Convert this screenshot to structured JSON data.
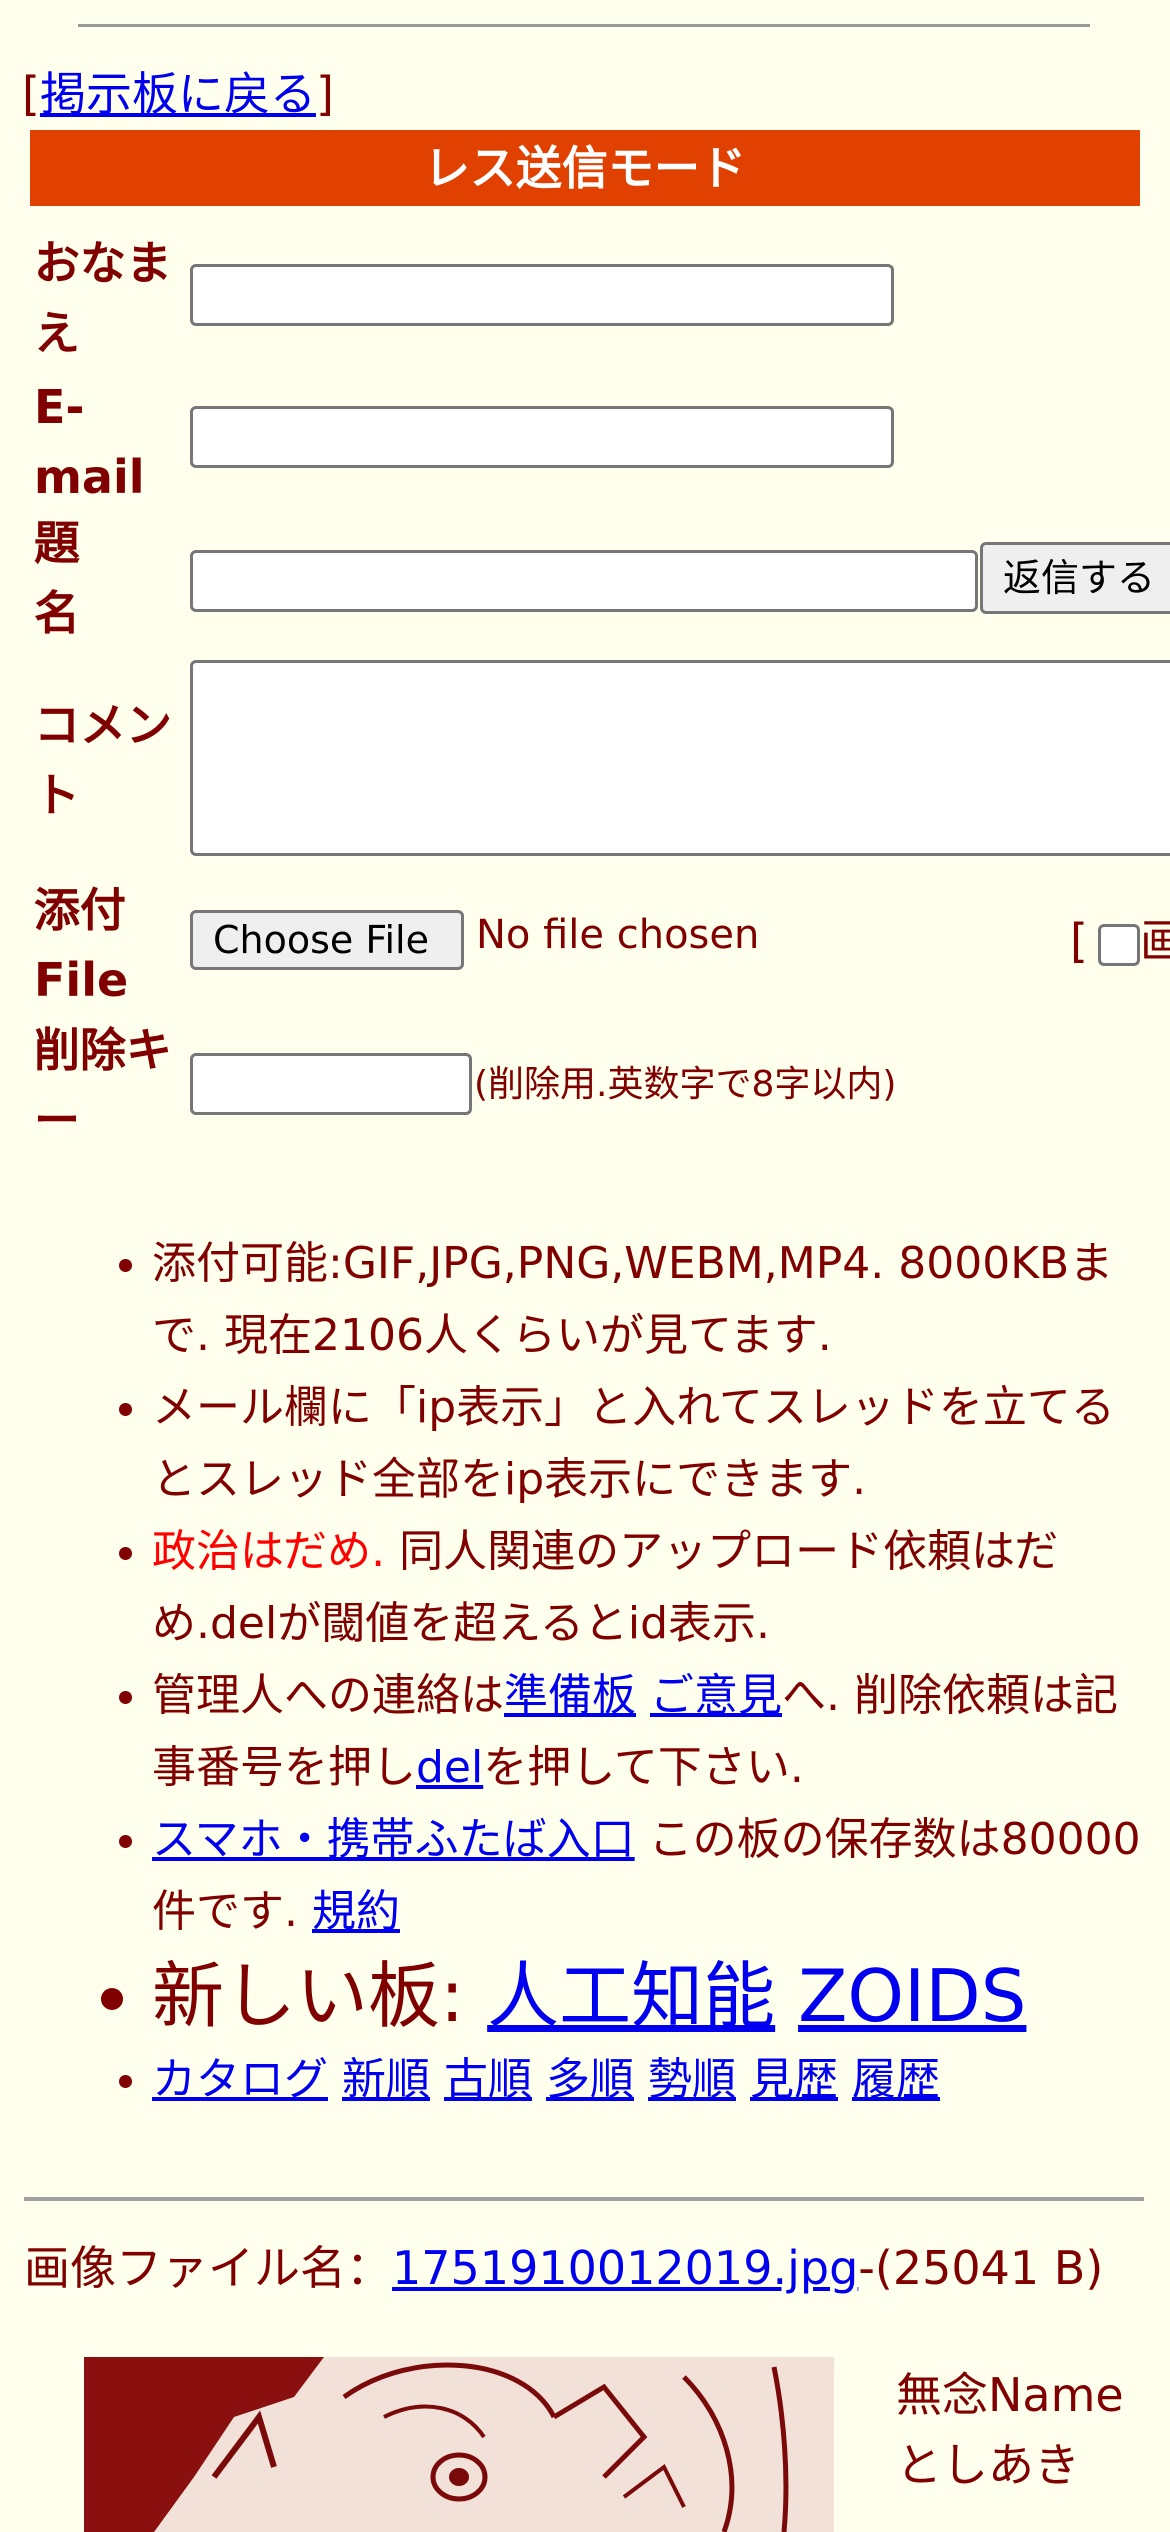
{
  "nav": {
    "back_link": "掲示板に戻る"
  },
  "form": {
    "mode_title": "レス送信モード",
    "label_name": "おなまえ",
    "label_email": "E-mail",
    "label_subject": "題名",
    "label_comment": "コメント",
    "label_file": "添付File",
    "label_delkey": "削除キー",
    "submit_label": "返信する",
    "file_button_label": "Choose File",
    "file_status": "No file chosen",
    "image_option_text": "画",
    "delkey_note": "(削除用.英数字で8字以内)"
  },
  "rules": {
    "r1": "添付可能:GIF,JPG,PNG,WEBM,MP4. 8000KBまで. 現在2106人くらいが見てます.",
    "r2": "メール欄に「ip表示」と入れてスレッドを立てるとスレッド全部をip表示にできます.",
    "r3_red": "政治はだめ.",
    "r3_rest": " 同人関連のアップロード依頼はだめ.delが閾値を超えるとid表示.",
    "r4_a": "管理人への連絡は",
    "r4_link1": "準備板",
    "r4_link2": "ご意見",
    "r4_b": "へ. 削除依頼は記事番号を押し",
    "r4_link3": "del",
    "r4_c": "を押して下さい.",
    "r5_link": "スマホ・携帯ふたば入口",
    "r5_text": " この板の保存数は80000件です. ",
    "r5_link2": "規約",
    "new_boards_label": "新しい板: ",
    "new_board_1": "人工知能",
    "new_board_2": "ZOIDS",
    "sort_links": [
      "カタログ",
      "新順",
      "古順",
      "多順",
      "勢順",
      "見歴",
      "履歴"
    ]
  },
  "post": {
    "file_label": "画像ファイル名：",
    "file_name": "1751910012019.jpg",
    "file_size": "-(25041 B)",
    "name_line": "無念Name",
    "poster_name": "としあき"
  }
}
